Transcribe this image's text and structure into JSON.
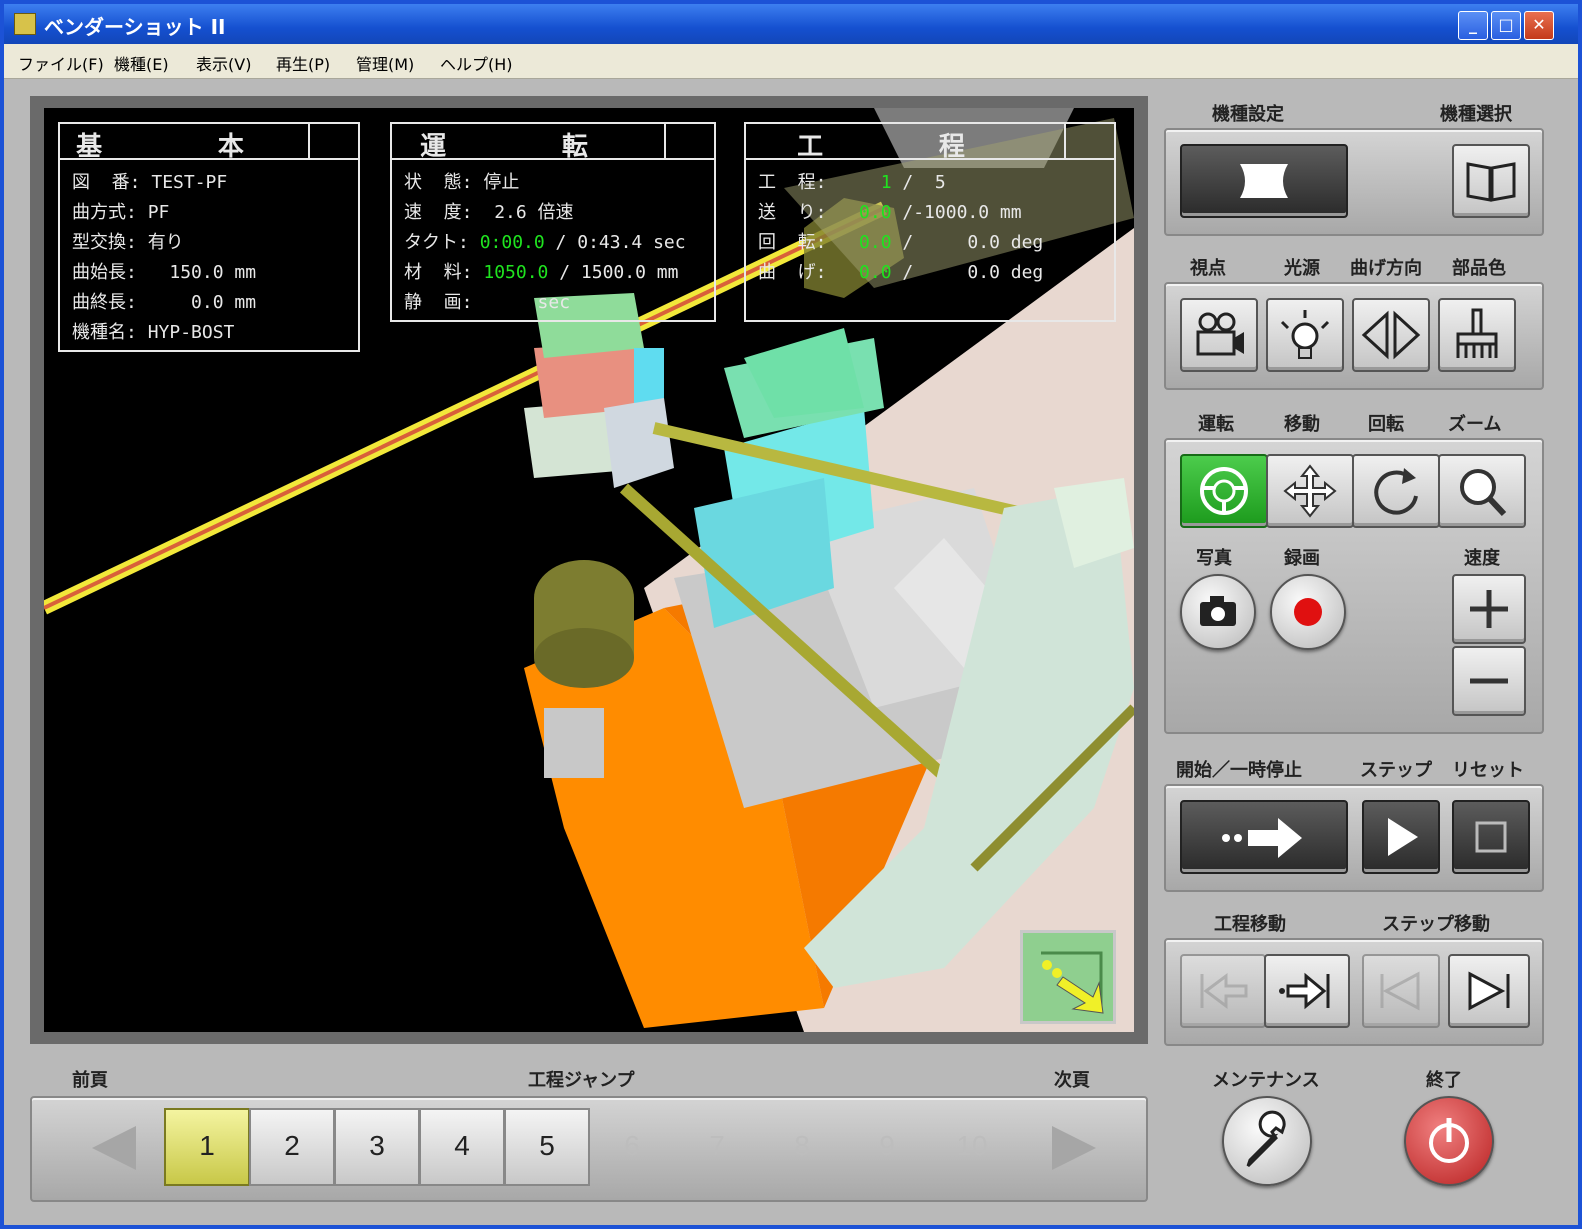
{
  "window": {
    "title": "ベンダーショット II"
  },
  "menu": [
    "ファイル(F)",
    "機種(E)",
    "表示(V)",
    "再生(P)",
    "管理(M)",
    "ヘルプ(H)"
  ],
  "info_basic": {
    "title": "基 本",
    "rows": [
      {
        "label": "図  番:",
        "value": "TEST-PF"
      },
      {
        "label": "曲方式:",
        "value": "PF"
      },
      {
        "label": "型交換:",
        "value": "有り"
      },
      {
        "label": "曲始長:",
        "value": "  150.0 mm"
      },
      {
        "label": "曲終長:",
        "value": "    0.0 mm"
      },
      {
        "label": "機種名:",
        "value": "HYP-BOST"
      }
    ]
  },
  "info_run": {
    "title": "運 転",
    "rows": [
      {
        "label": "状  態:",
        "value": "停止",
        "value2": ""
      },
      {
        "label": "速  度:",
        "value": " 2.6 倍速",
        "value2": ""
      },
      {
        "label": "タクト:",
        "value": "0:00.0",
        "value2": " / 0:43.4 sec"
      },
      {
        "label": "材  料:",
        "value": "1050.0",
        "value2": " / 1500.0 mm"
      },
      {
        "label": "静  画:",
        "value": "",
        "value2": "     sec"
      }
    ]
  },
  "info_process": {
    "title": "工 程",
    "rows": [
      {
        "label": "工  程:",
        "value": "    1",
        "value2": " /  5"
      },
      {
        "label": "送  り:",
        "value": "  0.0",
        "value2": " /-1000.0 mm"
      },
      {
        "label": "回  転:",
        "value": "  0.0",
        "value2": " /     0.0 deg"
      },
      {
        "label": "曲  げ:",
        "value": "  0.0",
        "value2": " /     0.0 deg"
      }
    ]
  },
  "right": {
    "model_setting": "機種設定",
    "model_select": "機種選択",
    "viewpoint": "視点",
    "light": "光源",
    "bend_dir": "曲げ方向",
    "part_color": "部品色",
    "run": "運転",
    "move": "移動",
    "rotate": "回転",
    "zoom": "ズーム",
    "photo": "写真",
    "record": "録画",
    "speed": "速度",
    "start_pause": "開始／一時停止",
    "step": "ステップ",
    "reset": "リセット",
    "process_move": "工程移動",
    "step_move": "ステップ移動",
    "maintenance": "メンテナンス",
    "exit": "終了"
  },
  "bottom": {
    "prev": "前頁",
    "jump": "工程ジャンプ",
    "next": "次頁",
    "pages": [
      "1",
      "2",
      "3",
      "4",
      "5",
      "6",
      "7",
      "8",
      "9",
      "10"
    ],
    "active_page": "1",
    "enabled_count": 5
  },
  "colors": {
    "accent": "#1fe31f",
    "title": "#1550d0",
    "active": "#2cb52c"
  }
}
